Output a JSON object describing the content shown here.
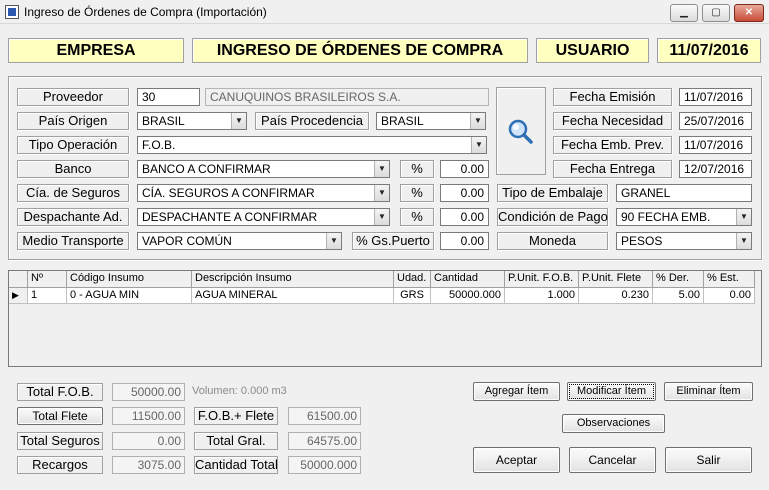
{
  "window": {
    "title": "Ingreso de Órdenes de Compra (Importación)",
    "minimize": "▁",
    "maximize": "▢",
    "close": "✕"
  },
  "header": {
    "empresa": "EMPRESA",
    "title": "INGRESO DE ÓRDENES DE COMPRA",
    "usuario": "USUARIO",
    "date": "11/07/2016"
  },
  "form": {
    "proveedor_label": "Proveedor",
    "proveedor_code": "30",
    "proveedor_name": "CANUQUINOS BRASILEIROS S.A.",
    "pais_origen_label": "País Origen",
    "pais_origen": "BRASIL",
    "pais_procedencia_label": "País Procedencia",
    "pais_procedencia": "BRASIL",
    "tipo_operacion_label": "Tipo Operación",
    "tipo_operacion": "F.O.B.",
    "banco_label": "Banco",
    "banco": "BANCO A CONFIRMAR",
    "banco_pct_label": "%",
    "banco_pct": "0.00",
    "seguros_label": "Cía. de Seguros",
    "seguros": "CÍA. SEGUROS A CONFIRMAR",
    "seguros_pct_label": "%",
    "seguros_pct": "0.00",
    "despachante_label": "Despachante Ad.",
    "despachante": "DESPACHANTE A CONFIRMAR",
    "despachante_pct_label": "%",
    "despachante_pct": "0.00",
    "medio_label": "Medio Transporte",
    "medio": "VAPOR COMÚN",
    "gs_puerto_label": "% Gs.Puerto",
    "gs_puerto": "0.00",
    "fecha_emision_label": "Fecha Emisión",
    "fecha_emision": "11/07/2016",
    "fecha_necesidad_label": "Fecha Necesidad",
    "fecha_necesidad": "25/07/2016",
    "fecha_emb_label": "Fecha Emb. Prev.",
    "fecha_emb": "11/07/2016",
    "fecha_entrega_label": "Fecha Entrega",
    "fecha_entrega": "12/07/2016",
    "tipo_embalaje_label": "Tipo de Embalaje",
    "tipo_embalaje": "GRANEL",
    "condicion_pago_label": "Condición de Pago",
    "condicion_pago": "90 FECHA EMB.",
    "moneda_label": "Moneda",
    "moneda": "PESOS"
  },
  "grid": {
    "columns": [
      "Nº",
      "Código Insumo",
      "Descripción Insumo",
      "Udad.",
      "Cantidad",
      "P.Unit. F.O.B.",
      "P.Unit. Flete",
      "% Der.",
      "% Est."
    ],
    "rows": [
      [
        "1",
        "0 - AGUA MIN",
        "AGUA MINERAL",
        "GRS",
        "50000.000",
        "1.000",
        "0.230",
        "5.00",
        "0.00"
      ]
    ],
    "row_indicator": "▶"
  },
  "totals": {
    "fob_label": "Total F.O.B.",
    "fob": "50000.00",
    "volumen": "Volumen: 0.000 m3",
    "flete_label": "Total Flete",
    "flete": "11500.00",
    "fob_flete_label": "F.O.B.+ Flete",
    "fob_flete": "61500.00",
    "seguros_label": "Total Seguros",
    "seguros": "0.00",
    "gral_label": "Total Gral.",
    "gral": "64575.00",
    "recargos_label": "Recargos",
    "recargos": "3075.00",
    "cantidad_label": "Cantidad Total",
    "cantidad": "50000.000"
  },
  "buttons": {
    "agregar": "Agregar Ítem",
    "modificar": "Modificar Ítem",
    "eliminar": "Eliminar Ítem",
    "observaciones": "Observaciones",
    "aceptar": "Aceptar",
    "cancelar": "Cancelar",
    "salir": "Salir"
  }
}
